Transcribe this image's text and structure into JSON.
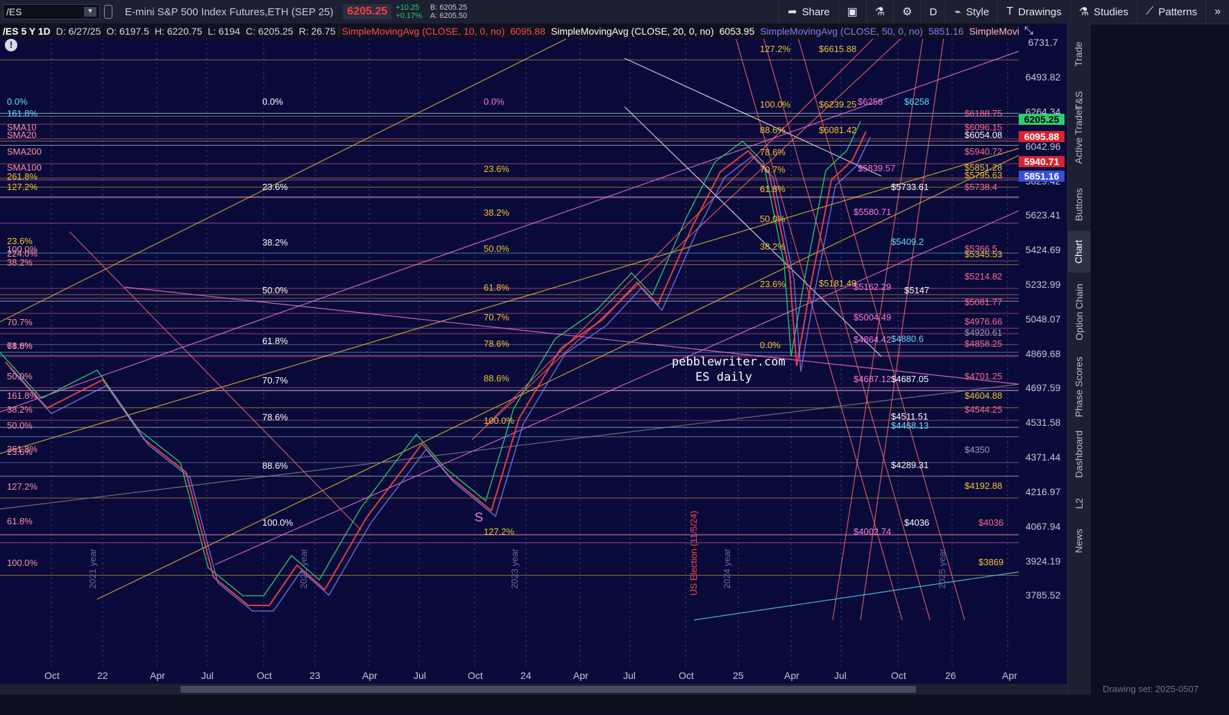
{
  "toolbar": {
    "symbol": "/ES",
    "description": "E-mini S&P 500 Index Futures,ETH (SEP 25)",
    "last_price": "6205.25",
    "change": "+10.25",
    "change_pct": "+0.17%",
    "bid": "B: 6205.25",
    "ask": "A: 6205.50",
    "share_label": "Share",
    "period_label": "D",
    "style_label": "Style",
    "drawings_label": "Drawings",
    "studies_label": "Studies",
    "patterns_label": "Patterns"
  },
  "studies": {
    "symbol_period": "/ES 5 Y 1D",
    "date": "D: 6/27/25",
    "open": "O: 6197.5",
    "high": "H: 6220.75",
    "low": "L: 6194",
    "close": "C: 6205.25",
    "range": "R: 26.75",
    "sma10": "SimpleMovingAvg (CLOSE, 10, 0, no)",
    "sma10_val": "6095.88",
    "sma20": "SimpleMovingAvg (CLOSE, 20, 0, no)",
    "sma20_val": "6053.95",
    "sma50": "SimpleMovingAvg (CLOSE, 50, 0, no)",
    "sma50_val": "5851.16",
    "sma_more": "SimpleMoving..."
  },
  "price_axis": [
    "6731.7",
    "6493.82",
    "6264.34",
    "6042.96",
    "5829.42",
    "5623.41",
    "5424.69",
    "5232.99",
    "5048.07",
    "4869.68",
    "4697.59",
    "4531.58",
    "4371.44",
    "4216.97",
    "4067.94",
    "3924.19",
    "3785.52"
  ],
  "price_tags": [
    {
      "text": "6205.25",
      "bg": "#2ecc71",
      "color": "#000000"
    },
    {
      "text": "6095.88",
      "bg": "#d9232e",
      "color": "#ffffff"
    },
    {
      "text": "5940.71",
      "bg": "#d9232e",
      "color": "#ffffff"
    },
    {
      "text": "5851.16",
      "bg": "#3a4fd8",
      "color": "#ffffff"
    }
  ],
  "time_axis": [
    "Oct",
    "22",
    "Apr",
    "Jul",
    "Oct",
    "23",
    "Apr",
    "Jul",
    "Oct",
    "24",
    "Apr",
    "Jul",
    "Oct",
    "25",
    "Apr",
    "Jul",
    "Oct",
    "26",
    "Apr"
  ],
  "fib_left": [
    "0.0%",
    "161.8%",
    "SMA10",
    "SMA20",
    "SMA200",
    "SMA100",
    "261.8%",
    "127.2%",
    "23.6%",
    "224.0%",
    "100.0%",
    "38.2%",
    "161.8%",
    "50.0%",
    "361.8%",
    "127.2%",
    "61.8%",
    "100.0%",
    "78.6%",
    "70.7%",
    "61.8%",
    "50.0%",
    "38.2%",
    "23.6%"
  ],
  "fib_mid1": [
    "0.0%",
    "23.6%",
    "38.2%",
    "50.0%",
    "61.8%",
    "70.7%",
    "78.6%",
    "88.6%",
    "100.0%"
  ],
  "fib_mid2": [
    "0.0%",
    "23.6%",
    "38.2%",
    "50.0%",
    "61.8%",
    "70.7%",
    "78.6%",
    "88.6%",
    "100.0%",
    "127.2%"
  ],
  "fib_right": [
    "127.2%",
    "100.0%",
    "88.6%",
    "78.6%",
    "70.7%",
    "61.8%",
    "50.0%",
    "38.2%",
    "23.6%",
    "0.0%"
  ],
  "levels_right": [
    {
      "text": "$6615.88",
      "color": "#f4c430"
    },
    {
      "text": "$6239.25",
      "color": "#f4c430"
    },
    {
      "text": "$6258",
      "color": "#ff79e0"
    },
    {
      "text": "$6258",
      "color": "#5ee0ff"
    },
    {
      "text": "$6188.75",
      "color": "#ff6b8a"
    },
    {
      "text": "$6096.15",
      "color": "#ff6b8a"
    },
    {
      "text": "$6081.42",
      "color": "#f4c430"
    },
    {
      "text": "$6054.08",
      "color": "#ffffff"
    },
    {
      "text": "$5940.72",
      "color": "#ff6b8a"
    },
    {
      "text": "$5839.57",
      "color": "#ff79e0"
    },
    {
      "text": "$5851.28",
      "color": "#f4c430"
    },
    {
      "text": "$5795.63",
      "color": "#f4c430"
    },
    {
      "text": "$5733.61",
      "color": "#ffffff"
    },
    {
      "text": "$5738.4",
      "color": "#ff6b8a"
    },
    {
      "text": "$5580.71",
      "color": "#ff79e0"
    },
    {
      "text": "$5409.2",
      "color": "#5ee0ff"
    },
    {
      "text": "$5366.5",
      "color": "#ff6b8a"
    },
    {
      "text": "$5345.53",
      "color": "#f4c430"
    },
    {
      "text": "$5214.82",
      "color": "#ff6b8a"
    },
    {
      "text": "$5181.49",
      "color": "#f4c430"
    },
    {
      "text": "$5162.29",
      "color": "#ff79e0"
    },
    {
      "text": "$5147",
      "color": "#ffffff"
    },
    {
      "text": "$5081.77",
      "color": "#ff6b8a"
    },
    {
      "text": "$5004.49",
      "color": "#ff79e0"
    },
    {
      "text": "$4976.66",
      "color": "#ff6b8a"
    },
    {
      "text": "$4920.61",
      "color": "#9aa0b4"
    },
    {
      "text": "$4880.6",
      "color": "#5ee0ff"
    },
    {
      "text": "$4864.42",
      "color": "#ff79e0"
    },
    {
      "text": "$4858.25",
      "color": "#ff6b8a"
    },
    {
      "text": "$4701.25",
      "color": "#ff6b8a"
    },
    {
      "text": "$4687.12",
      "color": "#ff79e0"
    },
    {
      "text": "$4687.05",
      "color": "#ffffff"
    },
    {
      "text": "$4604.88",
      "color": "#f4c430"
    },
    {
      "text": "$4544.25",
      "color": "#ff6b8a"
    },
    {
      "text": "$4511.51",
      "color": "#ffffff"
    },
    {
      "text": "$4468.13",
      "color": "#5ee0ff"
    },
    {
      "text": "$4350",
      "color": "#9aa0b4"
    },
    {
      "text": "$4289.31",
      "color": "#ffffff"
    },
    {
      "text": "$4192.88",
      "color": "#f4c430"
    },
    {
      "text": "$4036",
      "color": "#ffffff"
    },
    {
      "text": "$4036",
      "color": "#ff6b8a"
    },
    {
      "text": "$4002.74",
      "color": "#ff79e0"
    },
    {
      "text": "$3869",
      "color": "#f4c430"
    }
  ],
  "annotations": {
    "watermark_line1": "pebblewriter.com",
    "watermark_line2": "ES daily",
    "s_label": "S",
    "year_2021": "2021 year",
    "year_2022": "2022 year",
    "year_2023": "2023 year",
    "year_2024": "2024 year",
    "year_2025": "2025 year",
    "election": "US Election (11/5/24)"
  },
  "sidebar_tabs": [
    "Trade",
    "T&S",
    "Active Trader",
    "Buttons",
    "Chart",
    "Option Chain",
    "Phase Scores",
    "Dashboard",
    "L2",
    "News"
  ],
  "drawing_set": "Drawing set: 2025-0507",
  "colors": {
    "bg": "#0a0a3a",
    "sma10": "#ff4a4a",
    "sma20": "#ffffff",
    "sma50": "#7d7dff",
    "fib_yellow": "#f4c430",
    "pink": "#ff79e0",
    "salmon": "#ff6b6b",
    "cyan": "#5ee0ff"
  }
}
